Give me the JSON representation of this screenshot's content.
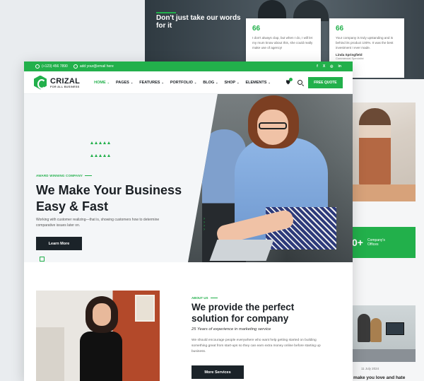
{
  "background": {
    "tagline": "Don't just take our words for it",
    "testimonials": [
      {
        "quote_mark": "66",
        "text": "I don't always clap, but when I do, I will let my mum know about this, she could really make use of agency!",
        "name": "",
        "role": ""
      },
      {
        "quote_mark": "66",
        "text": "Your company is truly upstanding and is behind its product 100%. It was the best investment I ever made.",
        "name": "Linda Springfield",
        "role": "Commercial Specialist"
      }
    ],
    "stat": {
      "number": "0+",
      "label": "Company's Offices"
    },
    "blog_date": "11 July 2024",
    "blog_title": "make you love and hate"
  },
  "topbar": {
    "phone": "(+123) 456 7890",
    "email": "add your@email here",
    "social": [
      "f",
      "X",
      "◎",
      "in"
    ]
  },
  "nav": {
    "logo_name": "CRIZAL",
    "logo_sub": "FOR ALL BUSINESS",
    "items": [
      {
        "label": "HOME",
        "active": true
      },
      {
        "label": "PAGES"
      },
      {
        "label": "FEATURES"
      },
      {
        "label": "PORTFOLIO"
      },
      {
        "label": "BLOG"
      },
      {
        "label": "SHOP"
      },
      {
        "label": "ELEMENTS"
      }
    ],
    "quote_button": "FREE QUOTE"
  },
  "hero": {
    "eyebrow": "AWARD WINNING COMPANY",
    "title": "We Make Your Business Easy & Fast",
    "description": "Working with customer realizing—that is, showing customers how to determine comparative issues later on.",
    "button": "Learn More"
  },
  "about": {
    "eyebrow": "ABOUT US",
    "title": "We provide the perfect solution for company",
    "subtitle": "25 Years of experience in marketing service",
    "description": "We should encourage people everywhere who want help getting started on building something great from start-ups so they can earn extra money online before starting up business.",
    "button": "More Services"
  },
  "colors": {
    "brand": "#22b04b",
    "dark": "#1b2329"
  }
}
